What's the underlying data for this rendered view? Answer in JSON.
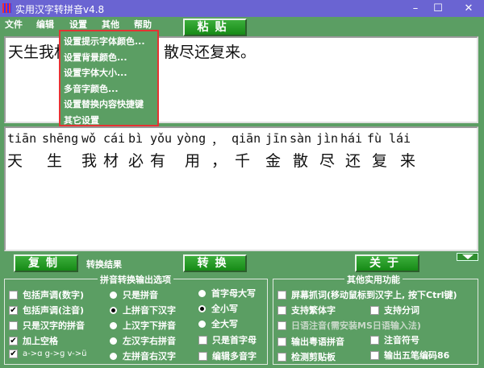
{
  "window": {
    "title": "实用汉字转拼音v4.8",
    "minimize": "–",
    "maximize": "☐",
    "close": "✕"
  },
  "menu": [
    "文件",
    "编辑",
    "设置",
    "其他",
    "帮助"
  ],
  "settings_menu": [
    "设置提示字体颜色...",
    "设置背景颜色...",
    "设置字体大小...",
    "多音字颜色...",
    "设置替换内容快捷键",
    "其它设置"
  ],
  "buttons": {
    "paste": "粘贴",
    "copy": "复制",
    "convert": "转换",
    "about": "关于"
  },
  "result_label": "转换结果",
  "source_text": {
    "visible_left": "天生我材",
    "visible_right": "散尽还复来。"
  },
  "output": {
    "pinyin": [
      "tiān",
      "shēng",
      "wǒ",
      "cái",
      "bì",
      "yǒu",
      "yòng",
      "，",
      "qiān",
      "jīn",
      "sàn",
      "jìn",
      "hái",
      "fù",
      "lái"
    ],
    "hanzi": [
      "天",
      "生",
      "我",
      "材",
      "必",
      "有",
      "用",
      "，",
      "千",
      "金",
      "散",
      "尽",
      "还",
      "复",
      "来"
    ]
  },
  "pinyin_options": {
    "title": "拼音转换输出选项",
    "checks": [
      {
        "label": "包括声调(数字)",
        "checked": false
      },
      {
        "label": "包括声调(注音)",
        "checked": true
      },
      {
        "label": "只是汉字的拼音",
        "checked": false
      },
      {
        "label": "加上空格",
        "checked": true
      },
      {
        "label": "a->ɑ g->ɡ v->ü",
        "checked": true
      }
    ],
    "layout_radios": [
      {
        "label": "只是拼音",
        "selected": false
      },
      {
        "label": "上拼音下汉字",
        "selected": true
      },
      {
        "label": "上汉字下拼音",
        "selected": false
      },
      {
        "label": "左汉字右拼音",
        "selected": false
      },
      {
        "label": "左拼音右汉字",
        "selected": false
      }
    ],
    "case_radios": [
      {
        "label": "首字母大写",
        "selected": false
      },
      {
        "label": "全小写",
        "selected": true
      },
      {
        "label": "全大写",
        "selected": false
      }
    ],
    "extra_checks": [
      {
        "label": "只是首字母",
        "checked": false
      },
      {
        "label": "编辑多音字",
        "checked": false
      }
    ]
  },
  "other_functions": {
    "title": "其他实用功能",
    "items": [
      {
        "label": "屏幕抓词(移动鼠标到汉字上, 按下Ctrl键)",
        "checked": false
      },
      {
        "label": "支持繁体字",
        "checked": false
      },
      {
        "label": "支持分词",
        "checked": false
      },
      {
        "label": "日语注音(需安装MS日语输入法)",
        "checked": false,
        "disabled": true
      },
      {
        "label": "输出粤语拼音",
        "checked": false
      },
      {
        "label": "注音符号",
        "checked": false
      },
      {
        "label": "检测剪贴板",
        "checked": false
      },
      {
        "label": "输出五笔编码86",
        "checked": false
      }
    ]
  }
}
